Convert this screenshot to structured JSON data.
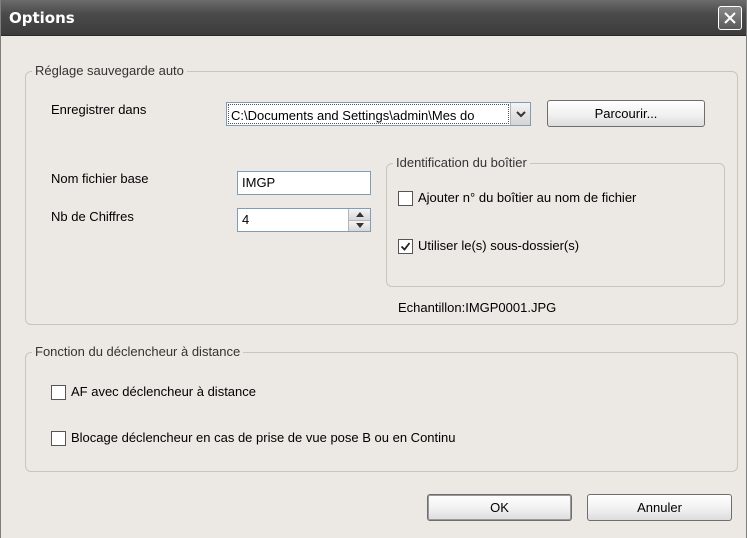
{
  "window": {
    "title": "Options"
  },
  "auto_save": {
    "legend": "Réglage sauvegarde auto",
    "save_in_label": "Enregistrer dans",
    "save_in_value": "C:\\Documents and Settings\\admin\\Mes do",
    "browse_label": "Parcourir...",
    "base_name_label": "Nom fichier base",
    "base_name_value": "IMGP",
    "digits_label": "Nb de Chiffres",
    "digits_value": "4",
    "sample_text": "Echantillon:IMGP0001.JPG"
  },
  "body_id": {
    "legend": "Identification du boîtier",
    "add_number_label": "Ajouter n° du boîtier au nom de fichier",
    "add_number_checked": false,
    "use_subfolders_label": "Utiliser le(s) sous-dossier(s)",
    "use_subfolders_checked": true
  },
  "remote": {
    "legend": "Fonction du déclencheur à distance",
    "af_label": "AF avec déclencheur à distance",
    "af_checked": false,
    "lock_label": "Blocage déclencheur en cas de prise de vue pose B ou en Continu",
    "lock_checked": false
  },
  "footer": {
    "ok_label": "OK",
    "cancel_label": "Annuler"
  },
  "icons": {
    "close": "close-icon",
    "dropdown": "chevron-down-icon",
    "spin_up": "triangle-up-icon",
    "spin_down": "triangle-down-icon",
    "check": "checkmark-icon"
  }
}
